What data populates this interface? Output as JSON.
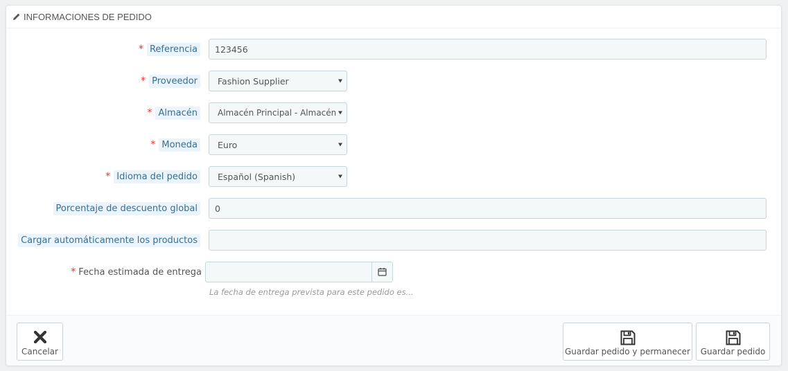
{
  "panel": {
    "title": "INFORMACIONES DE PEDIDO",
    "title_icon": "pencil-icon"
  },
  "fields": {
    "reference": {
      "label": "Referencia",
      "required": "*",
      "value": "123456"
    },
    "supplier": {
      "label": "Proveedor",
      "required": "*",
      "value": "Fashion Supplier"
    },
    "warehouse": {
      "label": "Almacén",
      "required": "*",
      "value": "Almacén Principal - Almacén"
    },
    "currency": {
      "label": "Moneda",
      "required": "*",
      "value": "Euro"
    },
    "language": {
      "label": "Idioma del pedido",
      "required": "*",
      "value": "Español (Spanish)"
    },
    "discount": {
      "label": "Porcentaje de descuento global",
      "value": "0"
    },
    "autoload": {
      "label": "Cargar automáticamente los productos",
      "value": ""
    },
    "delivery_date": {
      "label": "Fecha estimada de entrega",
      "required": "*",
      "value": "",
      "help": "La fecha de entrega prevista para este pedido es..."
    }
  },
  "footer": {
    "cancel_label": "Cancelar",
    "save_stay_label": "Guardar pedido y permanecer",
    "save_label": "Guardar pedido"
  },
  "colors": {
    "required": "#e4352b",
    "label_link": "#3a6e92",
    "label_bg": "#eaf4fa",
    "input_bg": "#f5f8f9"
  }
}
